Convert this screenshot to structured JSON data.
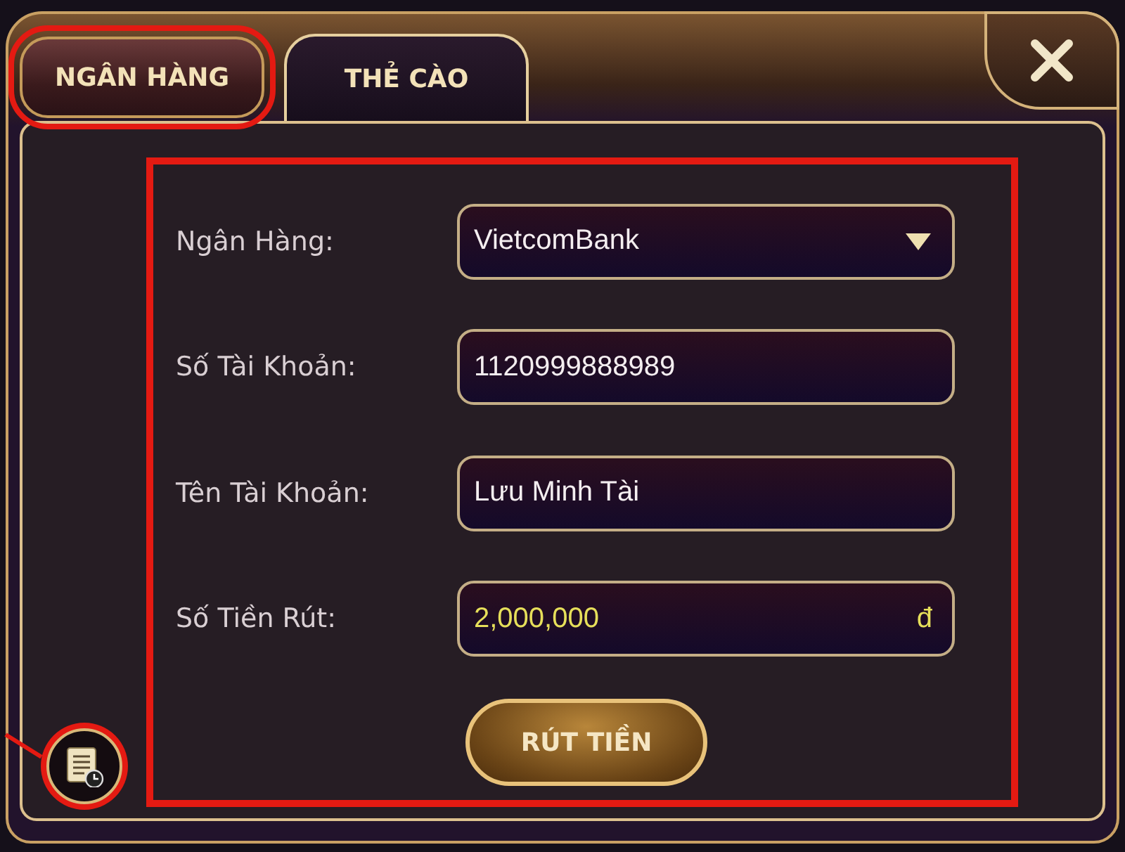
{
  "tabs": [
    {
      "label": "NGÂN HÀNG",
      "selected": true,
      "highlighted": true
    },
    {
      "label": "THẺ CÀO",
      "selected": false,
      "highlighted": false
    }
  ],
  "form": {
    "highlighted": true,
    "fields": [
      {
        "kind": "select",
        "label": "Ngân Hàng:",
        "value": "VietcomBank"
      },
      {
        "kind": "text",
        "label": "Số Tài Khoản:",
        "value": "1120999888989"
      },
      {
        "kind": "text",
        "label": "Tên Tài Khoản:",
        "value": "Lưu Minh Tài"
      },
      {
        "kind": "amount",
        "label": "Số Tiền Rút:",
        "value": "2,000,000",
        "suffix": "đ"
      }
    ],
    "submit": "RÚT TIỀN"
  },
  "history_button": {
    "highlighted": true
  }
}
